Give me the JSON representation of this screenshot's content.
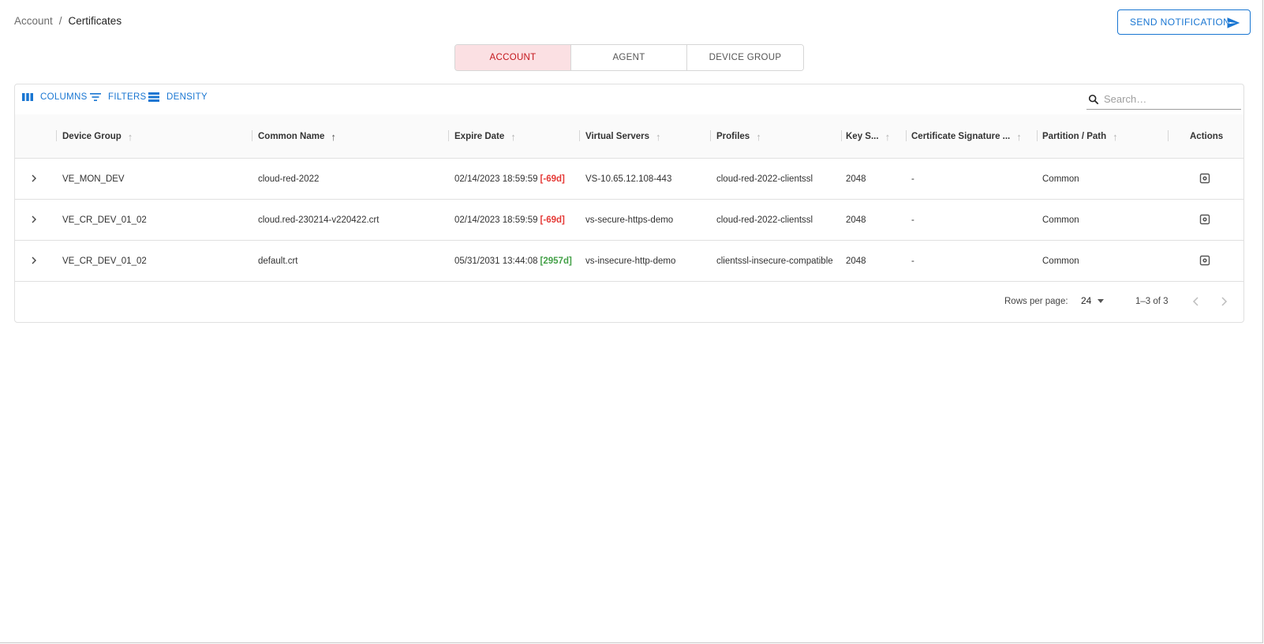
{
  "breadcrumb": {
    "parent": "Account",
    "separator": "/",
    "current": "Certificates"
  },
  "actions": {
    "send_notification": "SEND NOTIFICATION"
  },
  "tabs": [
    {
      "label": "ACCOUNT",
      "active": true
    },
    {
      "label": "AGENT",
      "active": false
    },
    {
      "label": "DEVICE GROUP",
      "active": false
    }
  ],
  "toolbar": {
    "columns": "COLUMNS",
    "filters": "FILTERS",
    "density": "DENSITY",
    "search_placeholder": "Search…"
  },
  "table": {
    "headers": {
      "device_group": "Device Group",
      "common_name": "Common Name",
      "expire_date": "Expire Date",
      "virtual_servers": "Virtual Servers",
      "profiles": "Profiles",
      "key_size": "Key S...",
      "cert_signature": "Certificate Signature ...",
      "partition": "Partition / Path",
      "actions": "Actions"
    },
    "rows": [
      {
        "device_group": "VE_MON_DEV",
        "common_name": "cloud-red-2022",
        "expire_date": "02/14/2023 18:59:59",
        "days": "[-69d]",
        "virtual_servers": "VS-10.65.12.108-443",
        "profiles": "cloud-red-2022-clientssl",
        "key_size": "2048",
        "cert_signature": "-",
        "partition": "Common"
      },
      {
        "device_group": "VE_CR_DEV_01_02",
        "common_name": "cloud.red-230214-v220422.crt",
        "expire_date": "02/14/2023 18:59:59",
        "days": "[-69d]",
        "virtual_servers": "vs-secure-https-demo",
        "profiles": "cloud-red-2022-clientssl",
        "key_size": "2048",
        "cert_signature": "-",
        "partition": "Common"
      },
      {
        "device_group": "VE_CR_DEV_01_02",
        "common_name": "default.crt",
        "expire_date": "05/31/2031 13:44:08",
        "days": "[2957d]",
        "virtual_servers": "vs-insecure-http-demo",
        "profiles": "clientssl-insecure-compatible",
        "key_size": "2048",
        "cert_signature": "-",
        "partition": "Common"
      }
    ]
  },
  "pagination": {
    "rows_per_page_label": "Rows per page:",
    "rows_per_page": "24",
    "range": "1–3 of 3"
  },
  "colors": {
    "primary": "#1976d2",
    "active_tab_bg": "#fbe0e3",
    "active_tab_text": "#c4161c",
    "expired": "#e53935",
    "valid": "#43a047"
  }
}
